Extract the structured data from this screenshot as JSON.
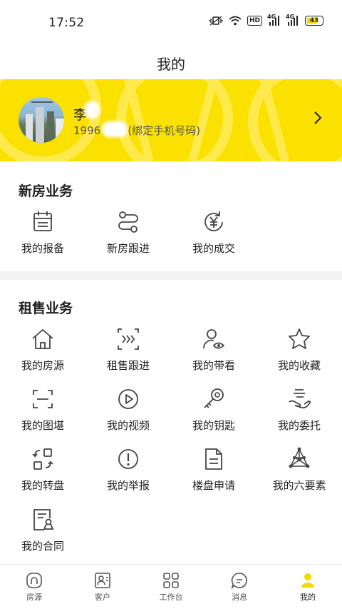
{
  "status_bar": {
    "time": "17:52",
    "network_a": "4G",
    "network_b": "4G",
    "hd": "HD",
    "battery": "43"
  },
  "header": {
    "title": "我的"
  },
  "profile": {
    "name": "李",
    "phone": "1996     706 (绑定手机号码)"
  },
  "colors": {
    "accent": "#fbe100",
    "text": "#222222"
  },
  "new_house": {
    "title": "新房业务",
    "items": [
      {
        "label": "我的报备",
        "icon": "calendar-icon"
      },
      {
        "label": "新房跟进",
        "icon": "route-icon"
      },
      {
        "label": "我的成交",
        "icon": "yuan-cycle-icon"
      }
    ]
  },
  "rental": {
    "title": "租售业务",
    "items": [
      {
        "label": "我的房源",
        "icon": "house-icon"
      },
      {
        "label": "租售跟进",
        "icon": "follow-icon"
      },
      {
        "label": "我的带看",
        "icon": "person-eye-icon"
      },
      {
        "label": "我的收藏",
        "icon": "star-icon"
      },
      {
        "label": "我的图堪",
        "icon": "scan-frame-icon"
      },
      {
        "label": "我的视频",
        "icon": "play-icon"
      },
      {
        "label": "我的钥匙",
        "icon": "key-icon"
      },
      {
        "label": "我的委托",
        "icon": "hand-icon"
      },
      {
        "label": "我的转盘",
        "icon": "transfer-icon"
      },
      {
        "label": "我的举报",
        "icon": "alert-icon"
      },
      {
        "label": "楼盘申请",
        "icon": "document-icon"
      },
      {
        "label": "我的六要素",
        "icon": "network-icon"
      },
      {
        "label": "我的合同",
        "icon": "contract-icon"
      }
    ]
  },
  "bottom_nav": [
    {
      "label": "房源",
      "icon": "house-tab-icon"
    },
    {
      "label": "客户",
      "icon": "customer-tab-icon"
    },
    {
      "label": "工作台",
      "icon": "workbench-tab-icon"
    },
    {
      "label": "消息",
      "icon": "message-tab-icon"
    },
    {
      "label": "我的",
      "icon": "mine-tab-icon",
      "active": true
    }
  ]
}
